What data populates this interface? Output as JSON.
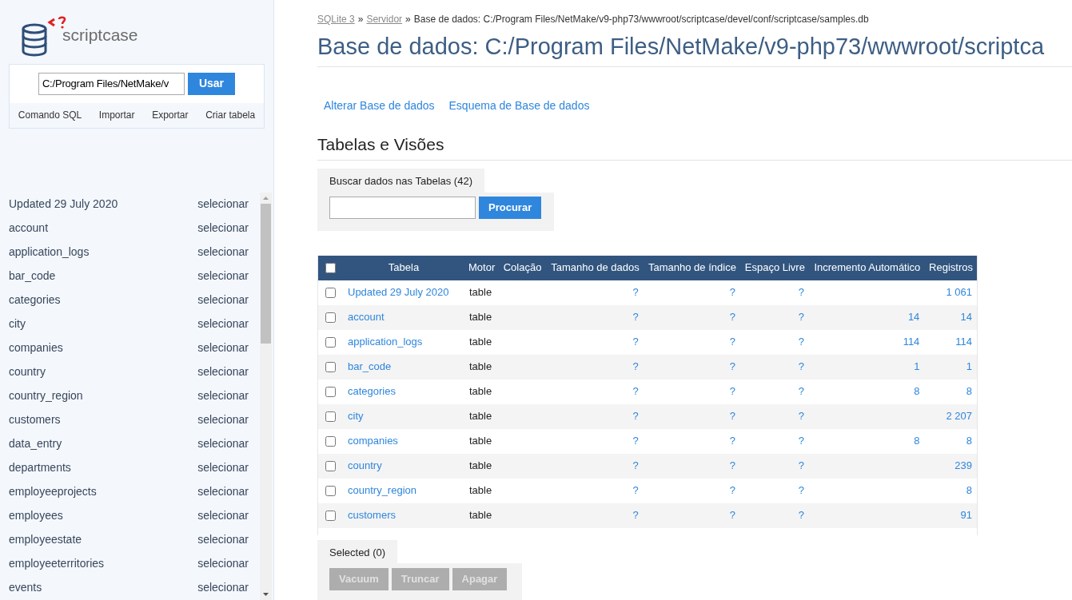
{
  "logo": {
    "brand": "scriptcase"
  },
  "sidebar": {
    "db_field": {
      "value": "C:/Program Files/NetMake/v"
    },
    "use_button": "Usar",
    "links": [
      "Comando SQL",
      "Importar",
      "Exportar",
      "Criar tabela"
    ],
    "tables": [
      {
        "name": "Updated 29 July 2020",
        "action": "selecionar"
      },
      {
        "name": "account",
        "action": "selecionar"
      },
      {
        "name": "application_logs",
        "action": "selecionar"
      },
      {
        "name": "bar_code",
        "action": "selecionar"
      },
      {
        "name": "categories",
        "action": "selecionar"
      },
      {
        "name": "city",
        "action": "selecionar"
      },
      {
        "name": "companies",
        "action": "selecionar"
      },
      {
        "name": "country",
        "action": "selecionar"
      },
      {
        "name": "country_region",
        "action": "selecionar"
      },
      {
        "name": "customers",
        "action": "selecionar"
      },
      {
        "name": "data_entry",
        "action": "selecionar"
      },
      {
        "name": "departments",
        "action": "selecionar"
      },
      {
        "name": "employeeprojects",
        "action": "selecionar"
      },
      {
        "name": "employees",
        "action": "selecionar"
      },
      {
        "name": "employeestate",
        "action": "selecionar"
      },
      {
        "name": "employeeterritories",
        "action": "selecionar"
      },
      {
        "name": "events",
        "action": "selecionar"
      }
    ]
  },
  "breadcrumb": {
    "links": [
      "SQLite 3",
      "Servidor"
    ],
    "separator": "»",
    "current": "Base de dados: C:/Program Files/NetMake/v9-php73/wwwroot/scriptcase/devel/conf/scriptcase/samples.db"
  },
  "page_title": "Base de dados: C:/Program Files/NetMake/v9-php73/wwwroot/scriptca",
  "actions": [
    "Alterar Base de dados",
    "Esquema de Base de dados"
  ],
  "section_title": "Tabelas e Visões",
  "search": {
    "label": "Buscar dados nas Tabelas (42)",
    "button": "Procurar"
  },
  "table": {
    "select_all_checked": false,
    "columns": [
      "Tabela",
      "Motor",
      "Colação",
      "Tamanho de dados",
      "Tamanho de índice",
      "Espaço Livre",
      "Incremento Automático",
      "Registros"
    ],
    "rows": [
      {
        "checked": false,
        "name": "Updated 29 July 2020",
        "engine": "table",
        "data_size": "?",
        "index_size": "?",
        "free": "?",
        "auto_increment": "",
        "records": "1 061"
      },
      {
        "checked": false,
        "name": "account",
        "engine": "table",
        "data_size": "?",
        "index_size": "?",
        "free": "?",
        "auto_increment": "14",
        "records": "14"
      },
      {
        "checked": false,
        "name": "application_logs",
        "engine": "table",
        "data_size": "?",
        "index_size": "?",
        "free": "?",
        "auto_increment": "114",
        "records": "114"
      },
      {
        "checked": false,
        "name": "bar_code",
        "engine": "table",
        "data_size": "?",
        "index_size": "?",
        "free": "?",
        "auto_increment": "1",
        "records": "1"
      },
      {
        "checked": false,
        "name": "categories",
        "engine": "table",
        "data_size": "?",
        "index_size": "?",
        "free": "?",
        "auto_increment": "8",
        "records": "8"
      },
      {
        "checked": false,
        "name": "city",
        "engine": "table",
        "data_size": "?",
        "index_size": "?",
        "free": "?",
        "auto_increment": "",
        "records": "2 207"
      },
      {
        "checked": false,
        "name": "companies",
        "engine": "table",
        "data_size": "?",
        "index_size": "?",
        "free": "?",
        "auto_increment": "8",
        "records": "8"
      },
      {
        "checked": false,
        "name": "country",
        "engine": "table",
        "data_size": "?",
        "index_size": "?",
        "free": "?",
        "auto_increment": "",
        "records": "239"
      },
      {
        "checked": false,
        "name": "country_region",
        "engine": "table",
        "data_size": "?",
        "index_size": "?",
        "free": "?",
        "auto_increment": "",
        "records": "8"
      },
      {
        "checked": false,
        "name": "customers",
        "engine": "table",
        "data_size": "?",
        "index_size": "?",
        "free": "?",
        "auto_increment": "",
        "records": "91"
      }
    ]
  },
  "selection": {
    "label": "Selected (0)",
    "buttons": [
      "Vacuum",
      "Truncar",
      "Apagar"
    ],
    "disabled": true
  }
}
